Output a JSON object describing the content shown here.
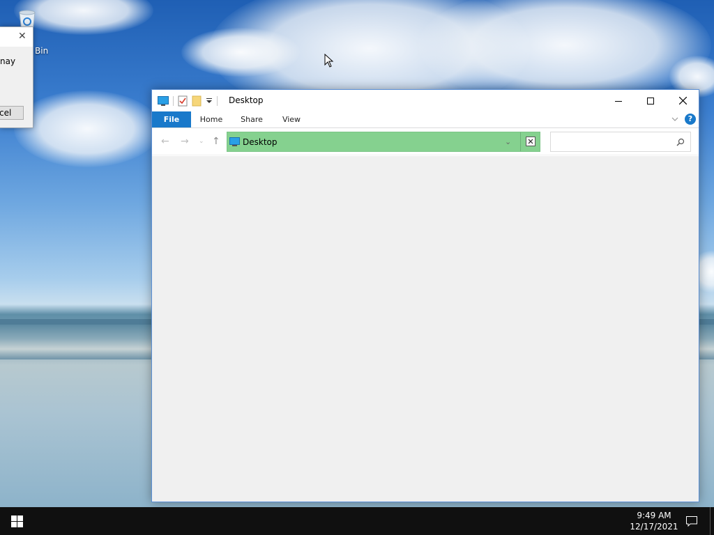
{
  "desktop": {
    "recycle_bin_label": "Bin"
  },
  "dialog": {
    "text_fragment": "nay",
    "button_fragment": "cel",
    "close_glyph": "✕"
  },
  "explorer": {
    "title": "Desktop",
    "tabs": [
      {
        "label": "File"
      },
      {
        "label": "Home"
      },
      {
        "label": "Share"
      },
      {
        "label": "View"
      }
    ],
    "address": {
      "value": "Desktop"
    },
    "search": {
      "placeholder": ""
    },
    "help_glyph": "?"
  },
  "taskbar": {
    "time": "9:49 AM",
    "date": "12/17/2021"
  },
  "colors": {
    "file_tab": "#1979ca",
    "address_highlight": "#85d18f",
    "taskbar": "#101010"
  }
}
